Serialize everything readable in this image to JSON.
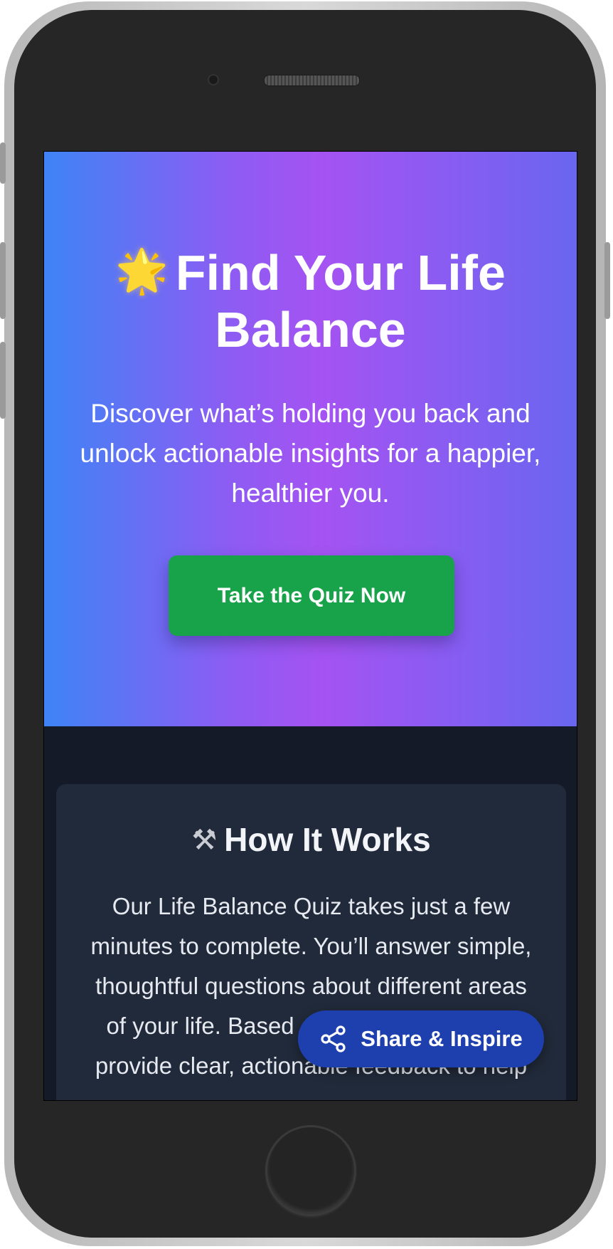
{
  "hero": {
    "icon": "glowing-star-icon",
    "icon_glyph": "🌟",
    "title": "Find Your Life Balance",
    "subtitle": "Discover what’s holding you back and unlock actionable insights for a happier, healthier you.",
    "cta_label": "Take the Quiz Now"
  },
  "how_it_works": {
    "icon": "hammer-and-wrench-icon",
    "icon_glyph": "⚒",
    "title": "How It Works",
    "body": "Our Life Balance Quiz takes just a few minutes to complete. You’ll answer simple, thoughtful questions about different areas of your life. Based on your answers, we provide clear, actionable feedback to help"
  },
  "share": {
    "icon": "share-icon",
    "label": "Share & Inspire"
  },
  "colors": {
    "hero_gradient_start": "#3e84f6",
    "hero_gradient_mid": "#a553f2",
    "hero_gradient_end": "#6966ef",
    "cta_green": "#18a24a",
    "page_dark": "#141a28",
    "card_bg": "#212a3a",
    "share_blue": "#1e3fae"
  }
}
